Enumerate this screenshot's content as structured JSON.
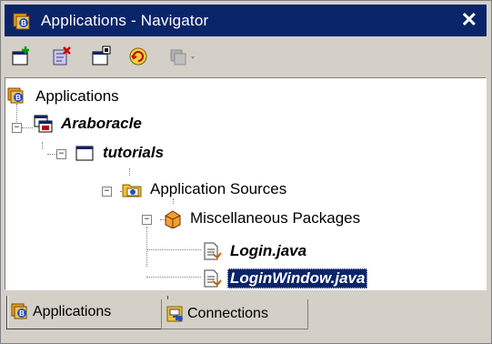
{
  "window": {
    "title": "Applications - Navigator",
    "close_glyph": "✕",
    "icon": "applications-navigator-icon"
  },
  "toolbar": {
    "buttons": [
      {
        "name": "new-application-button",
        "icon": "new-application-icon"
      },
      {
        "name": "remove-button",
        "icon": "remove-icon"
      },
      {
        "name": "new-project-button",
        "icon": "new-project-icon"
      },
      {
        "name": "refresh-button",
        "icon": "refresh-icon"
      },
      {
        "name": "project-menu-button",
        "icon": "project-dropdown-icon",
        "disabled": true
      }
    ]
  },
  "tree": {
    "root": "Applications",
    "application": "Araboracle",
    "project": "tutorials",
    "folder": "Application Sources",
    "package": "Miscellaneous Packages",
    "files": [
      "Login.java",
      "LoginWindow.java"
    ],
    "selected": "LoginWindow.java"
  },
  "tabs": [
    {
      "label": "Applications",
      "active": true
    },
    {
      "label": "Connections",
      "active": false
    }
  ],
  "colors": {
    "titlebar": "#0a246a",
    "selection": "#0a246a",
    "chrome": "#d4d0c8"
  }
}
